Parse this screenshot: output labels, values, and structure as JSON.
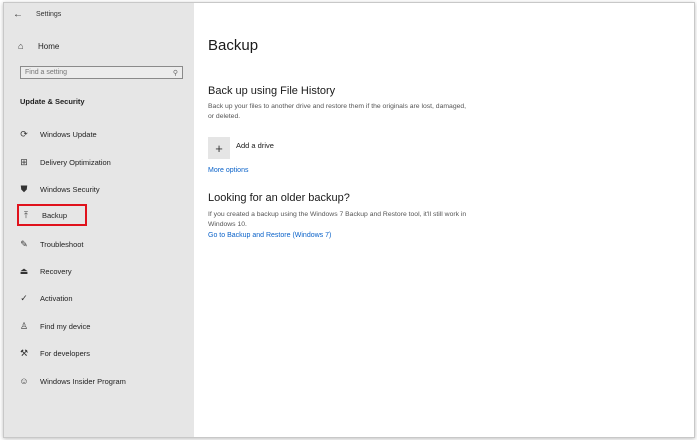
{
  "window": {
    "title": "Settings"
  },
  "titlebar": {
    "back_icon": "←"
  },
  "sidebar": {
    "home_label": "Home",
    "search_placeholder": "Find a setting",
    "section_title": "Update & Security",
    "items": [
      {
        "label": "Windows Update",
        "icon": "sync-icon",
        "glyph": "⟳"
      },
      {
        "label": "Delivery Optimization",
        "icon": "delivery-optimization-icon",
        "glyph": "⊞"
      },
      {
        "label": "Windows Security",
        "icon": "shield-icon",
        "glyph": "⛊"
      },
      {
        "label": "Backup",
        "icon": "backup-icon",
        "glyph": "⤒",
        "selected": true
      },
      {
        "label": "Troubleshoot",
        "icon": "wrench-icon",
        "glyph": "✎"
      },
      {
        "label": "Recovery",
        "icon": "recovery-icon",
        "glyph": "⏏"
      },
      {
        "label": "Activation",
        "icon": "check-circle-icon",
        "glyph": "✓"
      },
      {
        "label": "Find my device",
        "icon": "find-device-icon",
        "glyph": "♙"
      },
      {
        "label": "For developers",
        "icon": "developer-icon",
        "glyph": "⚒"
      },
      {
        "label": "Windows Insider Program",
        "icon": "insider-icon",
        "glyph": "☺"
      }
    ]
  },
  "main": {
    "page_title": "Backup",
    "file_history": {
      "title": "Back up using File History",
      "description": "Back up your files to another drive and restore them if the originals are lost, damaged, or deleted.",
      "add_drive_label": "Add a drive",
      "more_options_label": "More options"
    },
    "older_backup": {
      "title": "Looking for an older backup?",
      "description": "If you created a backup using the Windows 7 Backup and Restore tool, it'll still work in Windows 10.",
      "link_label": "Go to Backup and Restore (Windows 7)"
    }
  },
  "colors": {
    "sidebar_bg": "#e6e6e6",
    "link": "#0a62c9",
    "highlight_border": "#e0121c"
  }
}
